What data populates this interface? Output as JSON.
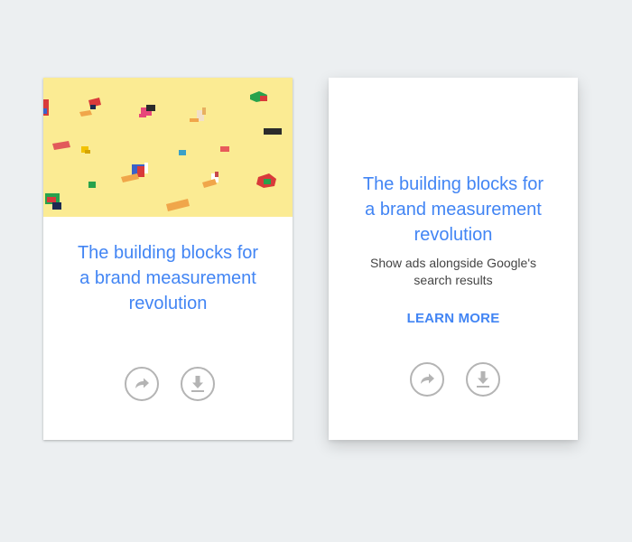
{
  "cards": [
    {
      "title_lines": [
        "The building blocks for",
        "a brand measurement",
        "revolution"
      ],
      "has_image": true,
      "actions": [
        {
          "icon": "share-icon"
        },
        {
          "icon": "download-icon"
        }
      ]
    },
    {
      "title_lines": [
        "The building blocks for",
        "a brand measurement",
        "revolution"
      ],
      "description_lines": [
        "Show ads alongside Google's",
        "search results"
      ],
      "cta_label": "LEARN MORE",
      "actions": [
        {
          "icon": "share-icon"
        },
        {
          "icon": "download-icon"
        }
      ]
    }
  ],
  "colors": {
    "background": "#eceff1",
    "card": "#ffffff",
    "title": "#4285f4",
    "hero_background": "#fbeb93",
    "icon": "#b4b4b4"
  }
}
